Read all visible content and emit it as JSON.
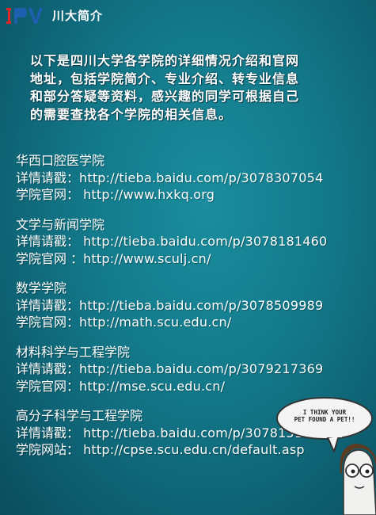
{
  "header": {
    "logo_text": "IPV",
    "title": "川大简介"
  },
  "intro": {
    "lines": [
      "以下是四川大学各学院的详细情况介绍和官网",
      "地址，包括学院简介、专业介绍、转专业信息",
      "和部分答疑等资料，感兴趣的同学可根据自己",
      "的需要查找各个学院的相关信息。"
    ]
  },
  "colleges": [
    {
      "name": "华西口腔医学院",
      "detail_label": "详情请戳：",
      "detail_url": "http://tieba.baidu.com/p/3078307054",
      "site_label": "学院官网： ",
      "site_url": "http://www.hxkq.org"
    },
    {
      "name": "文学与新闻学院",
      "detail_label": "详情请戳： ",
      "detail_url": "http://tieba.baidu.com/p/3078181460",
      "site_label": "学院官网  ：",
      "site_url": "http://www.sculj.cn/"
    },
    {
      "name": "数学学院",
      "detail_label": "详情请戳：",
      "detail_url": "http://tieba.baidu.com/p/3078509989",
      "site_label": "学院官网：",
      "site_url": "http://math.scu.edu.cn/"
    },
    {
      "name": "材料科学与工程学院",
      "detail_label": "详情请戳：",
      "detail_url": "http://tieba.baidu.com/p/3079217369",
      "site_label": "学院官网：",
      "site_url": "http://mse.scu.edu.cn/"
    },
    {
      "name": "高分子科学与工程学院",
      "detail_label": "详情请戳： ",
      "detail_url": "http://tieba.baidu.com/p/3078151574",
      "site_label": "学院网站： ",
      "site_url": "http://cpse.scu.edu.cn/default.asp"
    }
  ],
  "cartoon": {
    "bubble_line1": "I THINK YOUR",
    "bubble_line2": "PET FOUND A PET!!"
  },
  "colors": {
    "background": "#137a8b",
    "logo_red": "#e0262b",
    "logo_blue": "#1f5fb0",
    "text": "#ffffff"
  }
}
